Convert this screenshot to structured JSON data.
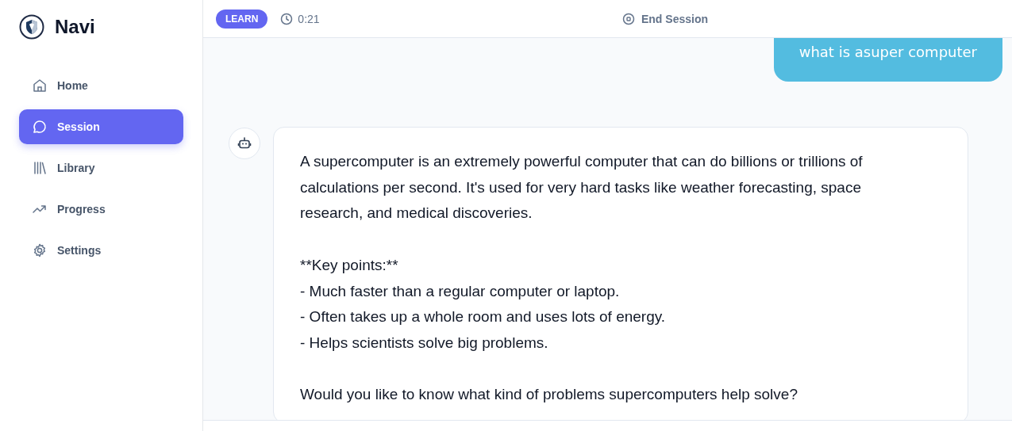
{
  "app": {
    "name": "Navi"
  },
  "sidebar": {
    "items": [
      {
        "label": "Home",
        "selected": false
      },
      {
        "label": "Session",
        "selected": true
      },
      {
        "label": "Library",
        "selected": false
      },
      {
        "label": "Progress",
        "selected": false
      },
      {
        "label": "Settings",
        "selected": false
      }
    ]
  },
  "header": {
    "mode_badge": "LEARN",
    "timer": "0:21",
    "end_button": "End Session"
  },
  "messages": [
    {
      "kind": "user",
      "text": "what is asuper computer"
    },
    {
      "kind": "assistant",
      "text": "A supercomputer is an extremely powerful computer that can do billions or trillions of calculations per second. It's used for very hard tasks like weather forecasting, space research, and medical discoveries.\n\n**Key points:**\n- Much faster than a regular computer or laptop.\n- Often takes up a whole room and uses lots of energy.\n- Helps scientists solve big problems.\n\nWould you like to know what kind of problems supercomputers help solve?"
    }
  ]
}
